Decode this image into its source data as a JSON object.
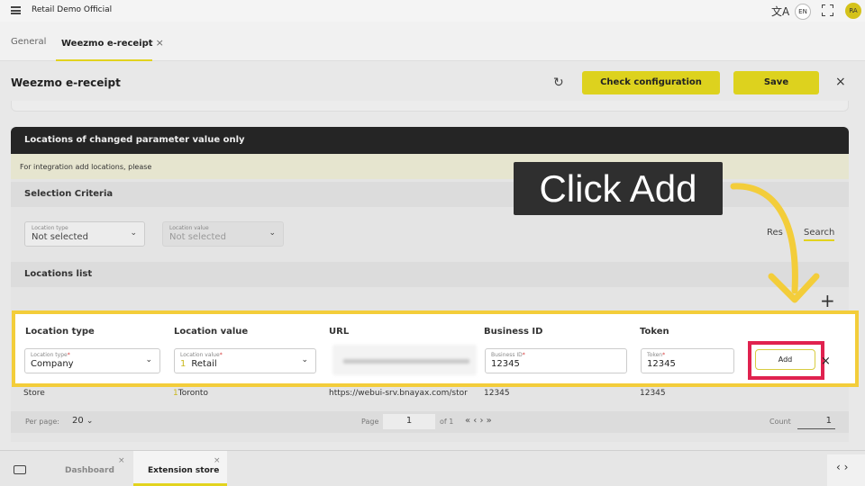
{
  "app": {
    "title": "Retail Demo Official",
    "lang_badge": "EN",
    "avatar_initials": "RA"
  },
  "tabs": [
    {
      "label": "General",
      "active": false
    },
    {
      "label": "Weezmo e-receipt",
      "active": true,
      "close": "×"
    }
  ],
  "page": {
    "title": "Weezmo e-receipt",
    "check_button": "Check configuration",
    "save_button": "Save",
    "close": "×",
    "refresh_icon": "↻"
  },
  "panel": {
    "header": "Locations of changed parameter value only",
    "info": "For integration add locations, please",
    "selection_title": "Selection Criteria",
    "location_type": {
      "label": "Location type",
      "value": "Not selected"
    },
    "location_value": {
      "label": "Location value",
      "value": "Not selected"
    },
    "reset_label": "Res",
    "search_label": "Search",
    "list_title": "Locations list",
    "add_plus": "+"
  },
  "new_row": {
    "headers": [
      "Location type",
      "Location value",
      "URL",
      "Business ID",
      "Token"
    ],
    "location_type": {
      "label": "Location type",
      "required": "*",
      "value": "Company"
    },
    "location_value": {
      "label": "Location value",
      "required": "*",
      "num": "1",
      "value": "Retail"
    },
    "business_id": {
      "label": "Business ID",
      "required": "*",
      "value": "12345"
    },
    "token": {
      "label": "Token",
      "required": "*",
      "value": "12345"
    },
    "add_button": "Add",
    "remove": "×"
  },
  "store_row": {
    "type": "Store",
    "value_num": "1",
    "value": "Toronto",
    "url": "https://webui-srv.bnayax.com/stor",
    "business_id": "12345",
    "token": "12345"
  },
  "pager": {
    "per_page_label": "Per page:",
    "per_page": "20",
    "page_label": "Page",
    "page": "1",
    "of": "of 1",
    "nav": "« ‹ › »",
    "count_label": "Count",
    "count": "1"
  },
  "bottom_tabs": [
    {
      "label": "Dashboard",
      "close": "×"
    },
    {
      "label": "Extension store",
      "close": "×"
    }
  ],
  "bottom_nav": "‹ ›",
  "callout": "Click Add",
  "colors": {
    "accent": "#ddd21e",
    "highlight": "#f3cd3a",
    "focus_red": "#e0224f"
  }
}
